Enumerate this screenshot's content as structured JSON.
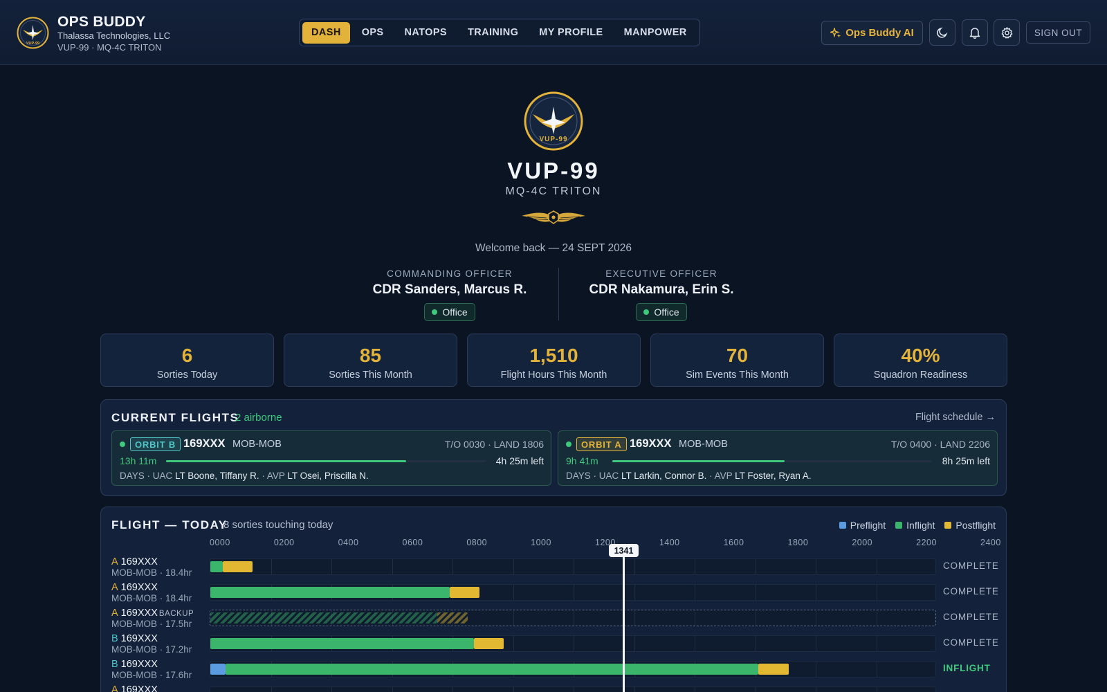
{
  "header": {
    "app_name": "OPS BUDDY",
    "company": "Thalassa Technologies, LLC",
    "unit_line": "VUP-99 · MQ-4C TRITON",
    "logo_text": "VUP-99",
    "nav": [
      {
        "label": "DASH",
        "active": true
      },
      {
        "label": "OPS",
        "active": false
      },
      {
        "label": "NATOPS",
        "active": false
      },
      {
        "label": "TRAINING",
        "active": false
      },
      {
        "label": "MY PROFILE",
        "active": false
      },
      {
        "label": "MANPOWER",
        "active": false
      }
    ],
    "ai_button": "Ops Buddy AI",
    "icons": [
      "moon-icon",
      "bell-icon",
      "gear-icon"
    ],
    "sign_out": "SIGN OUT"
  },
  "hero": {
    "crest_text": "VUP-99",
    "title": "VUP-99",
    "subtitle": "MQ-4C TRITON",
    "welcome": "Welcome back — 24 SEPT 2026"
  },
  "officers": [
    {
      "role": "COMMANDING OFFICER",
      "name": "CDR Sanders, Marcus R.",
      "location": "Office"
    },
    {
      "role": "EXECUTIVE OFFICER",
      "name": "CDR Nakamura, Erin S.",
      "location": "Office"
    }
  ],
  "stats": [
    {
      "value": "6",
      "label": "Sorties Today"
    },
    {
      "value": "85",
      "label": "Sorties This Month"
    },
    {
      "value": "1,510",
      "label": "Flight Hours This Month"
    },
    {
      "value": "70",
      "label": "Sim Events This Month"
    },
    {
      "value": "40%",
      "label": "Squadron Readiness"
    }
  ],
  "current_flights": {
    "title": "CURRENT FLIGHTS",
    "airborne": "2 airborne",
    "schedule_link": "Flight schedule →",
    "flights": [
      {
        "orbit": "ORBIT B",
        "orbit_color": "#4fc7c9",
        "tail": "169XXX",
        "route": "MOB-MOB",
        "times": "T/O 0030 · LAND 1806",
        "elapsed": "13h 11m",
        "remaining": "4h 25m left",
        "progress": 0.75,
        "shift": "DAYS",
        "uac_label": "UAC",
        "uac": "LT Boone, Tiffany R.",
        "avp_label": "AVP",
        "avp": "LT Osei, Priscilla N."
      },
      {
        "orbit": "ORBIT A",
        "orbit_color": "#e2b23a",
        "tail": "169XXX",
        "route": "MOB-MOB",
        "times": "T/O 0400 · LAND 2206",
        "elapsed": "9h 41m",
        "remaining": "8h 25m left",
        "progress": 0.54,
        "shift": "DAYS",
        "uac_label": "UAC",
        "uac": "LT Larkin, Connor B.",
        "avp_label": "AVP",
        "avp": "LT Foster, Ryan A."
      }
    ]
  },
  "flight_today": {
    "title": "FLIGHT — TODAY",
    "subtitle": "8 sorties touching today",
    "legend": [
      {
        "label": "Preflight",
        "color": "#5b9be0"
      },
      {
        "label": "Inflight",
        "color": "#3bb56c"
      },
      {
        "label": "Postflight",
        "color": "#e2b832"
      }
    ],
    "axis_labels": [
      "0000",
      "0200",
      "0400",
      "0600",
      "0800",
      "1000",
      "1200",
      "1400",
      "1600",
      "1800",
      "2000",
      "2200",
      "2400"
    ],
    "now_label": "1341",
    "now_hour": 13.68,
    "rows": [
      {
        "orbit": "A",
        "orbit_color": "#e2b23a",
        "tail": "169XXX",
        "backup": "",
        "sub": "MOB-MOB · 18.4hr",
        "dashed": false,
        "status": "COMPLETE",
        "inflight": false,
        "segments": [
          {
            "type": "inflight",
            "start": 0.0,
            "end": 0.4
          },
          {
            "type": "postflight",
            "start": 0.4,
            "end": 1.4
          }
        ]
      },
      {
        "orbit": "A",
        "orbit_color": "#e2b23a",
        "tail": "169XXX",
        "backup": "",
        "sub": "MOB-MOB · 18.4hr",
        "dashed": false,
        "status": "COMPLETE",
        "inflight": false,
        "segments": [
          {
            "type": "inflight",
            "start": 0.0,
            "end": 7.9
          },
          {
            "type": "postflight",
            "start": 7.9,
            "end": 8.9
          }
        ]
      },
      {
        "orbit": "A",
        "orbit_color": "#e2b23a",
        "tail": "169XXX",
        "backup": "BACKUP",
        "sub": "MOB-MOB · 17.5hr",
        "dashed": true,
        "status": "COMPLETE",
        "inflight": false,
        "segments": [
          {
            "type": "inflight",
            "start": 0.0,
            "end": 7.5
          },
          {
            "type": "postflight",
            "start": 7.5,
            "end": 8.5
          }
        ]
      },
      {
        "orbit": "B",
        "orbit_color": "#4fc7c9",
        "tail": "169XXX",
        "backup": "",
        "sub": "MOB-MOB · 17.2hr",
        "dashed": false,
        "status": "COMPLETE",
        "inflight": false,
        "segments": [
          {
            "type": "inflight",
            "start": 0.0,
            "end": 8.7
          },
          {
            "type": "postflight",
            "start": 8.7,
            "end": 9.7
          }
        ]
      },
      {
        "orbit": "B",
        "orbit_color": "#4fc7c9",
        "tail": "169XXX",
        "backup": "",
        "sub": "MOB-MOB · 17.6hr",
        "dashed": false,
        "status": "INFLIGHT",
        "inflight": true,
        "segments": [
          {
            "type": "preflight",
            "start": 0.0,
            "end": 0.5
          },
          {
            "type": "inflight",
            "start": 0.5,
            "end": 18.1
          },
          {
            "type": "postflight",
            "start": 18.1,
            "end": 19.1
          }
        ]
      },
      {
        "orbit": "A",
        "orbit_color": "#e2b23a",
        "tail": "169XXX",
        "backup": "",
        "sub": "",
        "dashed": false,
        "status": "",
        "inflight": false,
        "segments": []
      }
    ]
  }
}
